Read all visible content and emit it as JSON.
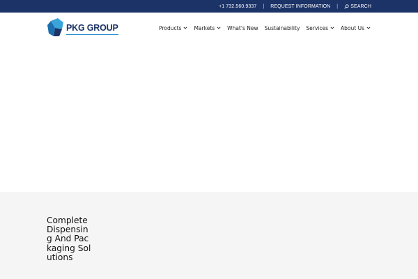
{
  "topbar": {
    "phone": "+1 732.560.9337",
    "separator": "|",
    "request_info": "REQUEST INFORMATION",
    "search_label": "SEARCH",
    "search_icon": "magnifier-icon",
    "background": "#1c3367"
  },
  "header": {
    "logo": {
      "text": "PKG GROUP",
      "mark_icon": "pkg-box-logo",
      "color": "#1c3367",
      "accent": "#2b8fd1"
    },
    "nav": [
      {
        "label": "Products",
        "dropdown": true
      },
      {
        "label": "Markets",
        "dropdown": true
      },
      {
        "label": "What's New",
        "dropdown": false
      },
      {
        "label": "Sustainability",
        "dropdown": false
      },
      {
        "label": "Services",
        "dropdown": true
      },
      {
        "label": "About Us",
        "dropdown": true
      }
    ]
  },
  "main": {
    "tagline": "Complete Dispensing And Packaging Solutions",
    "section_background": "#f5f5f5"
  }
}
